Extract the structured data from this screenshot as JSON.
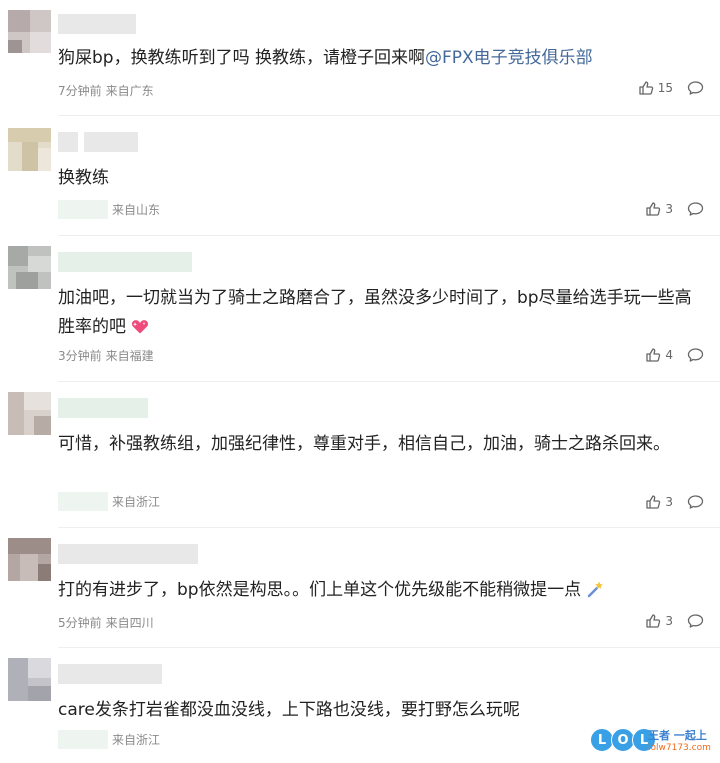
{
  "comments": [
    {
      "text_prefix": "狗屎bp，换教练听到了吗 换教练，请橙子回来啊",
      "mention": "@FPX电子竞技俱乐部",
      "time": "7分钟前",
      "location": "来自广东",
      "likes": "15"
    },
    {
      "text": "换教练",
      "location": "来自山东",
      "likes": "3"
    },
    {
      "text": "加油吧，一切就当为了骑士之路磨合了，虽然没多少时间了，bp尽量给选手玩一些高胜率的吧",
      "emoji": "sparkling-heart",
      "time": "3分钟前",
      "location": "来自福建",
      "likes": "4"
    },
    {
      "text": "可惜，补强教练组，加强纪律性，尊重对手，相信自己，加油，骑士之路杀回来。",
      "location": "来自浙江",
      "likes": "3"
    },
    {
      "text": "打的有进步了，bp依然是构思。。们上单这个优先级能不能稍微提一点",
      "emoji": "sparkle-wand",
      "time": "5分钟前",
      "location": "来自四川",
      "likes": "3"
    },
    {
      "text": "care发条打岩雀都没血没线，上下路也没线，要打野怎么玩呢",
      "location": "来自浙江"
    }
  ],
  "watermark": {
    "letters": [
      "L",
      "O",
      "L"
    ],
    "title": "王者 一起上",
    "url": "lolw7173.com"
  },
  "colors": {
    "mention": "#44699a",
    "meta_text": "#8a8a8a",
    "divider": "#eeeeee",
    "watermark_blue": "#3aa0e6",
    "watermark_orange": "#f06a1c"
  },
  "icons": {
    "like": "thumbs-up-icon",
    "reply": "comment-bubble-icon"
  }
}
